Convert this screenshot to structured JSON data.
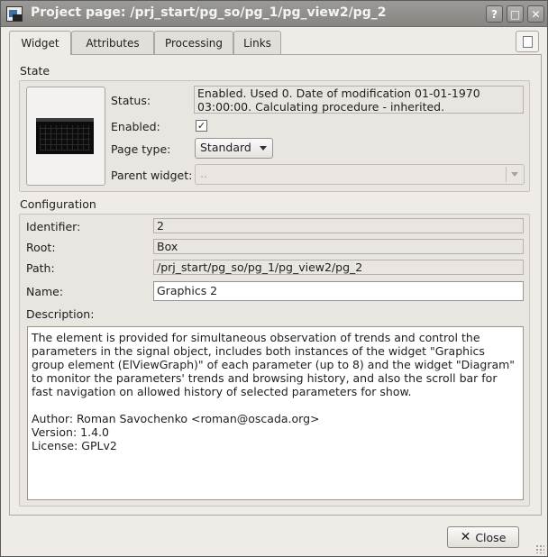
{
  "window": {
    "title": "Project page: /prj_start/pg_so/pg_1/pg_view2/pg_2",
    "help_glyph": "?",
    "max_glyph": "□",
    "close_glyph": "✕"
  },
  "tabs": [
    {
      "label": "Widget",
      "active": true
    },
    {
      "label": "Attributes",
      "active": false
    },
    {
      "label": "Processing",
      "active": false
    },
    {
      "label": "Links",
      "active": false
    }
  ],
  "state": {
    "section_title": "State",
    "status_label": "Status:",
    "status_value": "Enabled. Used 0. Date of modification 01-01-1970 03:00:00. Calculating procedure - inherited.",
    "enabled_label": "Enabled:",
    "enabled_checked": true,
    "check_glyph": "✓",
    "page_type_label": "Page type:",
    "page_type_value": "Standard",
    "parent_widget_label": "Parent widget:",
    "parent_widget_value": ".."
  },
  "configuration": {
    "section_title": "Configuration",
    "identifier_label": "Identifier:",
    "identifier_value": "2",
    "root_label": "Root:",
    "root_value": "Box",
    "path_label": "Path:",
    "path_value": "/prj_start/pg_so/pg_1/pg_view2/pg_2",
    "name_label": "Name:",
    "name_value": "Graphics 2",
    "description_label": "Description:",
    "description_value": "The element is provided for simultaneous observation of trends and control the parameters in the signal object, includes both instances of the widget \"Graphics group element (ElViewGraph)\" of each parameter (up to 8) and the widget \"Diagram\" to monitor the parameters' trends and browsing history, and also the scroll bar for fast navigation on allowed history of selected parameters for show.\n\nAuthor: Roman Savochenko <roman@oscada.org>\nVersion: 1.4.0\nLicense: GPLv2"
  },
  "footer": {
    "close_label": "Close",
    "close_icon": "✕"
  },
  "colors": {
    "titlebar": "#8f8d8a",
    "window_bg": "#efebe7",
    "field_bg": "#ffffff"
  }
}
